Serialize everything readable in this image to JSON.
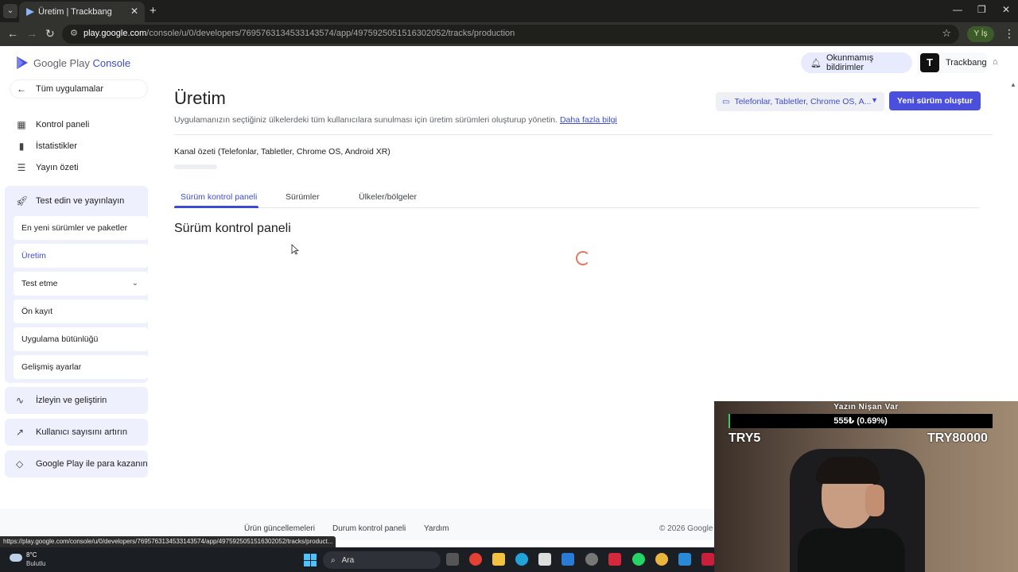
{
  "browser": {
    "tab_title": "Üretim | Trackbang",
    "url_host": "play.google.com",
    "url_path": "/console/u/0/developers/7695763134533143574/app/4975925051516302052/tracks/production",
    "profile_badge": "Y  İş"
  },
  "header": {
    "brand_google": "Google Play",
    "brand_console": "Console",
    "notifications_label": "Okunmamış bildirimler",
    "account_avatar": "T",
    "account_name": "Trackbang"
  },
  "sidebar": {
    "back_label": "Tüm uygulamalar",
    "items": [
      {
        "label": "Kontrol paneli",
        "icon": "dashboard-icon"
      },
      {
        "label": "İstatistikler",
        "icon": "bar-chart-icon"
      },
      {
        "label": "Yayın özeti",
        "icon": "publishing-overview-icon"
      }
    ],
    "test_group": {
      "label": "Test edin ve yayınlayın",
      "icon": "rocket-icon",
      "sub_items": [
        {
          "label": "En yeni sürümler ve paketler"
        },
        {
          "label": "Üretim",
          "active": true
        },
        {
          "label": "Test etme",
          "expandable": true
        },
        {
          "label": "Ön kayıt"
        },
        {
          "label": "Uygulama bütünlüğü"
        },
        {
          "label": "Gelişmiş ayarlar"
        }
      ]
    },
    "groups": [
      {
        "label": "İzleyin ve geliştirin",
        "icon": "pulse-icon"
      },
      {
        "label": "Kullanıcı sayısını artırın",
        "icon": "growth-icon"
      },
      {
        "label": "Google Play ile para kazanın",
        "icon": "tag-icon"
      }
    ]
  },
  "main": {
    "title": "Üretim",
    "description": "Uygulamanızın seçtiğiniz ülkelerdeki tüm kullanıcılara sunulması için üretim sürümleri oluşturup yönetin.",
    "learn_more": "Daha fazla bilgi",
    "device_filter": "Telefonlar, Tabletler, Chrome OS, A...",
    "new_release_button": "Yeni sürüm oluştur",
    "channel_summary": "Kanal özeti (Telefonlar, Tabletler, Chrome OS, Android XR)",
    "tabs": [
      {
        "label": "Sürüm kontrol paneli",
        "active": true
      },
      {
        "label": "Sürümler"
      },
      {
        "label": "Ülkeler/bölgeler"
      }
    ],
    "section_title": "Sürüm kontrol paneli"
  },
  "footer": {
    "links": [
      "Ürün güncellemeleri",
      "Durum kontrol paneli",
      "Yardım"
    ],
    "copyright": "© 2026 Google"
  },
  "status_url": "https://play.google.com/console/u/0/developers/7695763134533143574/app/4975925051516302052/tracks/product...",
  "taskbar": {
    "weather_temp": "8°C",
    "weather_desc": "Bulutlu",
    "search_placeholder": "Ara"
  },
  "stream_overlay": {
    "goal_title": "Yazın Nişan Var",
    "goal_progress_text": "555₺ (0.69%)",
    "goal_progress_fraction": 0.0069,
    "goal_min": "TRY5",
    "goal_max": "TRY80000"
  },
  "colors": {
    "accent": "#3c4cd0",
    "primary_button": "#4a4fdd",
    "sidebar_group_bg": "#eef0fd",
    "goal_fill": "#2ed15a"
  }
}
